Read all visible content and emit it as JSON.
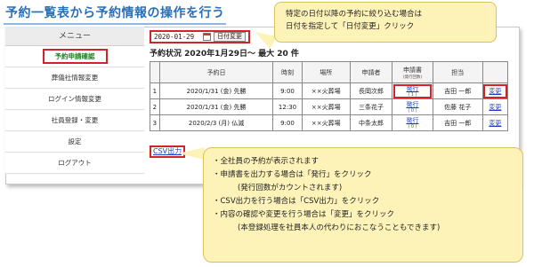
{
  "page": {
    "title": "予約一覧表から予約情報の操作を行う"
  },
  "sidebar": {
    "header": "メニュー",
    "items": [
      {
        "label": "予約申請確認",
        "active": true
      },
      {
        "label": "葬儀社情報変更",
        "active": false
      },
      {
        "label": "ログイン情報変更",
        "active": false
      },
      {
        "label": "社員登録・変更",
        "active": false
      },
      {
        "label": "設定",
        "active": false
      },
      {
        "label": "ログアウト",
        "active": false
      }
    ]
  },
  "filter": {
    "date_value": "2020-01-29",
    "date_button": "日付変更"
  },
  "status_line": "予約状況 2020年1月29日～ 最大 20 件",
  "table": {
    "headers": {
      "reserve_date": "予約日",
      "time": "時刻",
      "place": "場所",
      "applicant": "申請者",
      "form": "申請書",
      "form_sub": "(発行回数)",
      "assignee": "担当"
    },
    "rows": [
      {
        "no": "1",
        "date": "2020/1/31 (金) 先勝",
        "time": "9:00",
        "place": "××火葬場",
        "applicant": "長岡次郎",
        "issue": "発行",
        "issue_count": "( 1 )",
        "assignee": "吉田 一郎",
        "edit": "変更"
      },
      {
        "no": "2",
        "date": "2020/1/31 (金) 先勝",
        "time": "12:30",
        "place": "××火葬場",
        "applicant": "三条花子",
        "issue": "発行",
        "issue_count": "( 0 )",
        "assignee": "佐藤 花子",
        "edit": "変更"
      },
      {
        "no": "3",
        "date": "2020/2/3 (月) 仏滅",
        "time": "9:00",
        "place": "××火葬場",
        "applicant": "中条太郎",
        "issue": "発行",
        "issue_count": "( 0 )",
        "assignee": "吉田 一郎",
        "edit": "変更"
      }
    ]
  },
  "csv_button": "CSV出力",
  "callout_top": {
    "line1": "特定の日付以降の予約に絞り込む場合は",
    "line2": "日付を指定して「日付変更」クリック"
  },
  "callout_bottom": {
    "l1": "・全社員の予約が表示されます",
    "l2": "・申請書を出力する場合は「発行」をクリック",
    "l3": "(発行回数がカウントされます)",
    "l4": "・CSV出力を行う場合は「CSV出力」をクリック",
    "l5": "・内容の確認や変更を行う場合は「変更」をクリック",
    "l6": "(本登録処理を社員本人の代わりにおこなうこともできます)"
  },
  "colors": {
    "accent_title": "#2a70b8",
    "highlight": "#d2232a",
    "callout_bg": "#fdf2b8",
    "link": "#1a3fc4",
    "active_menu": "#1f7d1f"
  }
}
